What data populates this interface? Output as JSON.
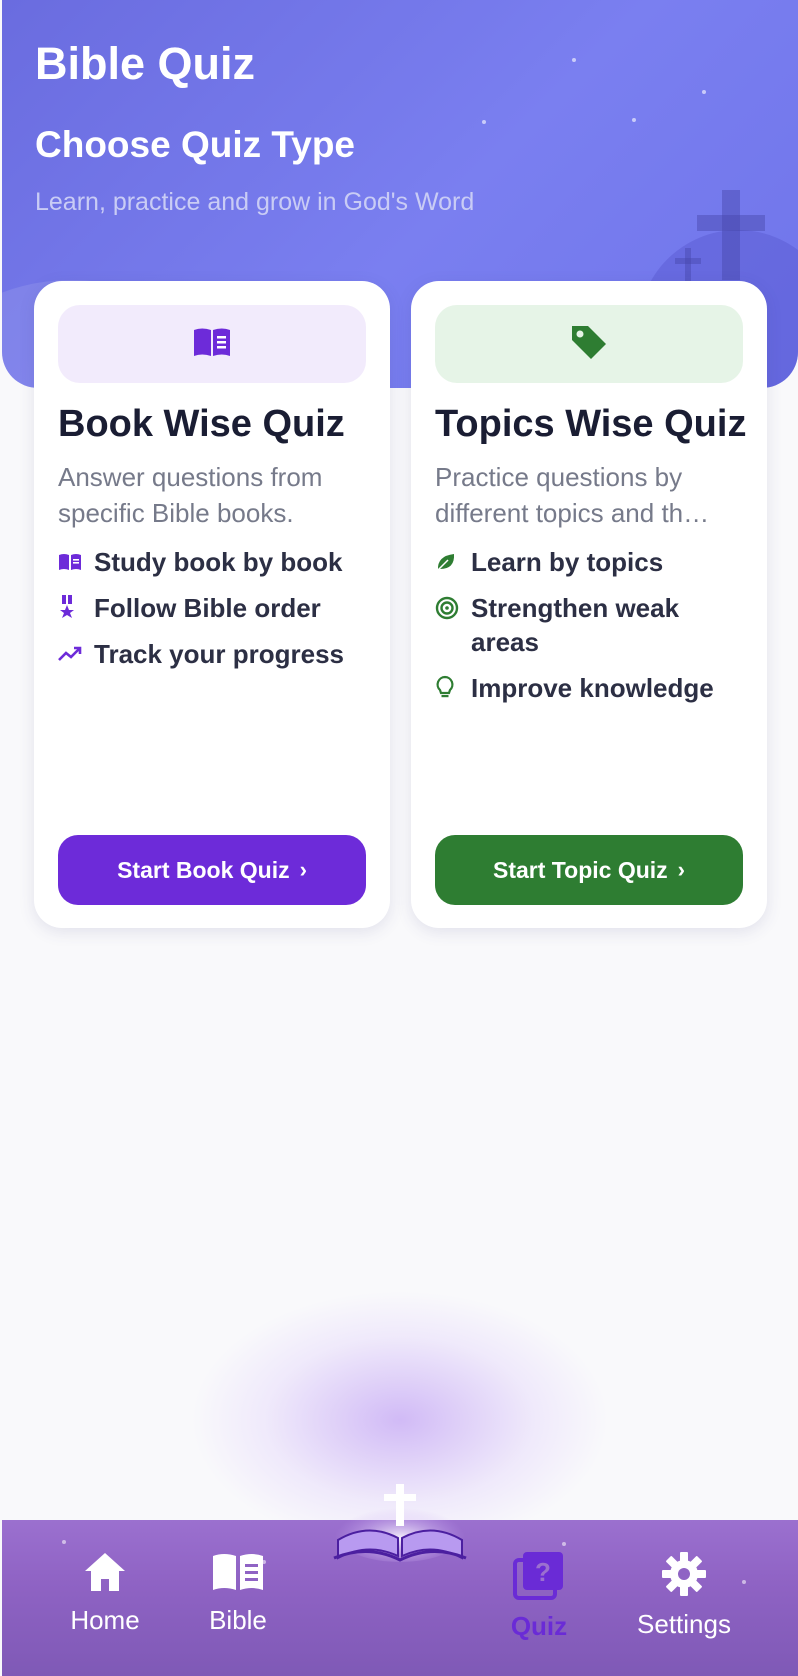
{
  "header": {
    "app_title": "Bible Quiz",
    "section_title": "Choose Quiz Type",
    "section_subtitle": "Learn, practice and grow in God's Word"
  },
  "cards": [
    {
      "id": "book",
      "icon": "open-book-icon",
      "title": "Book Wise Quiz",
      "description": "Answer questions from specific Bible books.",
      "features": [
        {
          "icon": "book-icon",
          "label": "Study book by book"
        },
        {
          "icon": "medal-icon",
          "label": "Follow Bible order"
        },
        {
          "icon": "trending-up-icon",
          "label": "Track your progress"
        }
      ],
      "button_label": "Start Book Quiz",
      "accent": "#6d2bd9"
    },
    {
      "id": "topic",
      "icon": "tag-icon",
      "title": "Topics Wise Quiz",
      "description_line1": "Practice questions by",
      "description_line2": "different topics and th…",
      "features": [
        {
          "icon": "leaf-icon",
          "label": "Learn by topics"
        },
        {
          "icon": "target-icon",
          "label": "Strengthen weak areas"
        },
        {
          "icon": "lightbulb-icon",
          "label": "Improve knowledge"
        }
      ],
      "button_label": "Start Topic Quiz",
      "accent": "#2e7d32"
    }
  ],
  "nav": {
    "items": [
      {
        "icon": "home-icon",
        "label": "Home"
      },
      {
        "icon": "bible-icon",
        "label": "Bible"
      },
      {
        "icon": "quiz-icon",
        "label": "Quiz",
        "active": true
      },
      {
        "icon": "settings-icon",
        "label": "Settings"
      }
    ],
    "center_icon": "glowing-bible-cross-icon"
  }
}
